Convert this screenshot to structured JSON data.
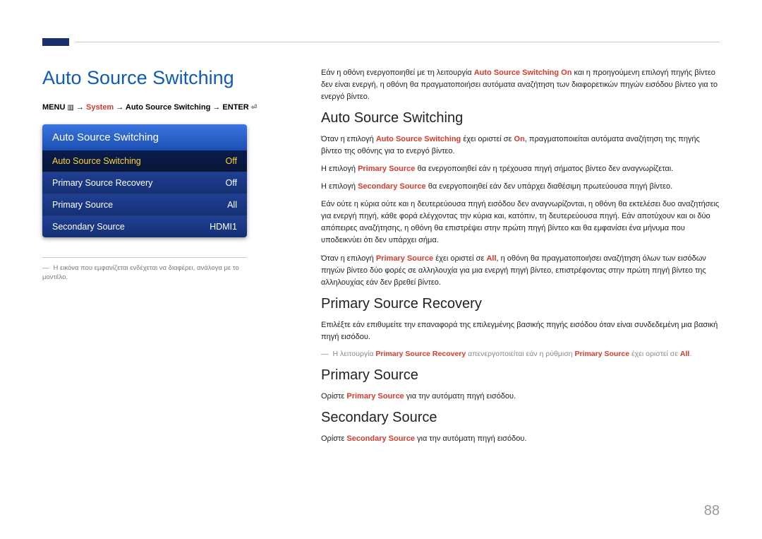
{
  "page_title": "Auto Source Switching",
  "breadcrumb": {
    "menu": "MENU",
    "arrow": "→",
    "system": "System",
    "feature": "Auto Source Switching",
    "enter": "ENTER"
  },
  "menu": {
    "header": "Auto Source Switching",
    "rows": [
      {
        "label": "Auto Source Switching",
        "value": "Off"
      },
      {
        "label": "Primary Source Recovery",
        "value": "Off"
      },
      {
        "label": "Primary Source",
        "value": "All"
      },
      {
        "label": "Secondary Source",
        "value": "HDMI1"
      }
    ]
  },
  "disclaimer": "Η εικόνα που εμφανίζεται ενδέχεται να διαφέρει, ανάλογα με το μοντέλο.",
  "intro": {
    "p1a": "Εάν η οθόνη ενεργοποιηθεί με τη λειτουργία ",
    "p1b": "Auto Source Switching On",
    "p1c": " και η προηγούμενη επιλογή πηγής βίντεο δεν είναι ενεργή, η οθόνη θα πραγματοποιήσει αυτόματα αναζήτηση των διαφορετικών πηγών εισόδου βίντεο για το ενεργό βίντεο."
  },
  "section1": {
    "heading": "Auto Source Switching",
    "p1a": "Όταν η επιλογή ",
    "p1_hl1": "Auto Source Switching",
    "p1b": " έχει οριστεί σε ",
    "p1_hl2": "On",
    "p1c": ", πραγματοποιείται αυτόματα αναζήτηση της πηγής βίντεο της οθόνης για το ενεργό βίντεο.",
    "p2a": "Η επιλογή ",
    "p2_hl": "Primary Source",
    "p2b": " θα ενεργοποιηθεί εάν η τρέχουσα πηγή σήματος βίντεο δεν αναγνωρίζεται.",
    "p3a": "Η επιλογή ",
    "p3_hl": "Secondary Source",
    "p3b": " θα ενεργοποιηθεί εάν δεν υπάρχει διαθέσιμη πρωτεύουσα πηγή βίντεο.",
    "p4": "Εάν ούτε η κύρια ούτε και η δευτερεύουσα πηγή εισόδου δεν αναγνωρίζονται, η οθόνη θα εκτελέσει δυο αναζητήσεις για ενεργή πηγή, κάθε φορά ελέγχοντας την κύρια και, κατόπιν, τη δευτερεύουσα πηγή. Εάν αποτύχουν και οι δύο απόπειρες αναζήτησης, η οθόνη θα επιστρέψει στην πρώτη πηγή βίντεο και θα εμφανίσει ένα μήνυμα που υποδεικνύει ότι δεν υπάρχει σήμα.",
    "p5a": "Όταν η επιλογή ",
    "p5_hl1": "Primary Source",
    "p5b": " έχει οριστεί σε ",
    "p5_hl2": "All",
    "p5c": ", η οθόνη θα πραγματοποιήσει αναζήτηση όλων των εισόδων πηγών βίντεο δύο φορές σε αλληλουχία για μια ενεργή πηγή βίντεο, επιστρέφοντας στην πρώτη πηγή βίντεο της αλληλουχίας εάν δεν βρεθεί βίντεο."
  },
  "section2": {
    "heading": "Primary Source Recovery",
    "p1": "Επιλέξτε εάν επιθυμείτε την επαναφορά της επιλεγμένης βασικής πηγής εισόδου όταν είναι συνδεδεμένη μια βασική πηγή εισόδου.",
    "note_a": "Η λειτουργία ",
    "note_hl1": "Primary Source Recovery",
    "note_b": " απενεργοποιείται εάν η ρύθμιση ",
    "note_hl2": "Primary Source",
    "note_c": " έχει οριστεί σε ",
    "note_hl3": "All",
    "note_d": "."
  },
  "section3": {
    "heading": "Primary Source",
    "p1a": "Ορίστε ",
    "p1_hl": "Primary Source",
    "p1b": " για την αυτόματη πηγή εισόδου."
  },
  "section4": {
    "heading": "Secondary Source",
    "p1a": "Ορίστε ",
    "p1_hl": "Secondary Source",
    "p1b": " για την αυτόματη πηγή εισόδου."
  },
  "page_number": "88"
}
